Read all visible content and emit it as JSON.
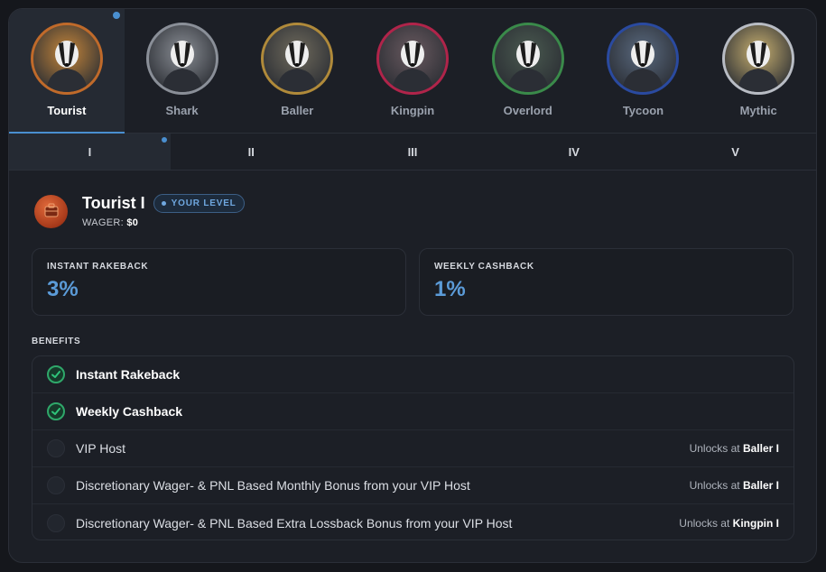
{
  "tiers": [
    {
      "name": "Tourist",
      "ring": "#c06a2a",
      "bg": "#c5863a",
      "active": true
    },
    {
      "name": "Shark",
      "ring": "#8a8f98",
      "bg": "#8b8f96",
      "active": false
    },
    {
      "name": "Baller",
      "ring": "#b08a3a",
      "bg": "#6f6a5c",
      "active": false
    },
    {
      "name": "Kingpin",
      "ring": "#b0244a",
      "bg": "#6a5a60",
      "active": false
    },
    {
      "name": "Overlord",
      "ring": "#3a8a4a",
      "bg": "#4a5a50",
      "active": false
    },
    {
      "name": "Tycoon",
      "ring": "#2a4aa0",
      "bg": "#5a6a80",
      "active": false
    },
    {
      "name": "Mythic",
      "ring": "#b8bcc4",
      "bg": "#c8b070",
      "active": false
    }
  ],
  "levels": [
    "I",
    "II",
    "III",
    "IV",
    "V"
  ],
  "current": {
    "title": "Tourist I",
    "badge": "YOUR LEVEL",
    "wager_label": "WAGER:",
    "wager_value": "$0"
  },
  "stats": [
    {
      "label": "INSTANT RAKEBACK",
      "value": "3%"
    },
    {
      "label": "WEEKLY CASHBACK",
      "value": "1%"
    }
  ],
  "benefits_label": "BENEFITS",
  "benefits": [
    {
      "text": "Instant Rakeback",
      "unlocked": true,
      "unlock_prefix": "",
      "unlock_tier": ""
    },
    {
      "text": "Weekly Cashback",
      "unlocked": true,
      "unlock_prefix": "",
      "unlock_tier": ""
    },
    {
      "text": "VIP Host",
      "unlocked": false,
      "unlock_prefix": "Unlocks at",
      "unlock_tier": "Baller I"
    },
    {
      "text": "Discretionary Wager- & PNL Based Monthly Bonus from your VIP Host",
      "unlocked": false,
      "unlock_prefix": "Unlocks at",
      "unlock_tier": "Baller I"
    },
    {
      "text": "Discretionary Wager- & PNL Based Extra Lossback Bonus from your VIP Host",
      "unlocked": false,
      "unlock_prefix": "Unlocks at",
      "unlock_tier": "Kingpin I"
    }
  ],
  "colors": {
    "accent": "#4a8fd0",
    "value": "#5b9bd8",
    "check": "#2fa86a"
  },
  "icons": {
    "check": "check-icon",
    "badge": "tourist-badge-icon"
  }
}
